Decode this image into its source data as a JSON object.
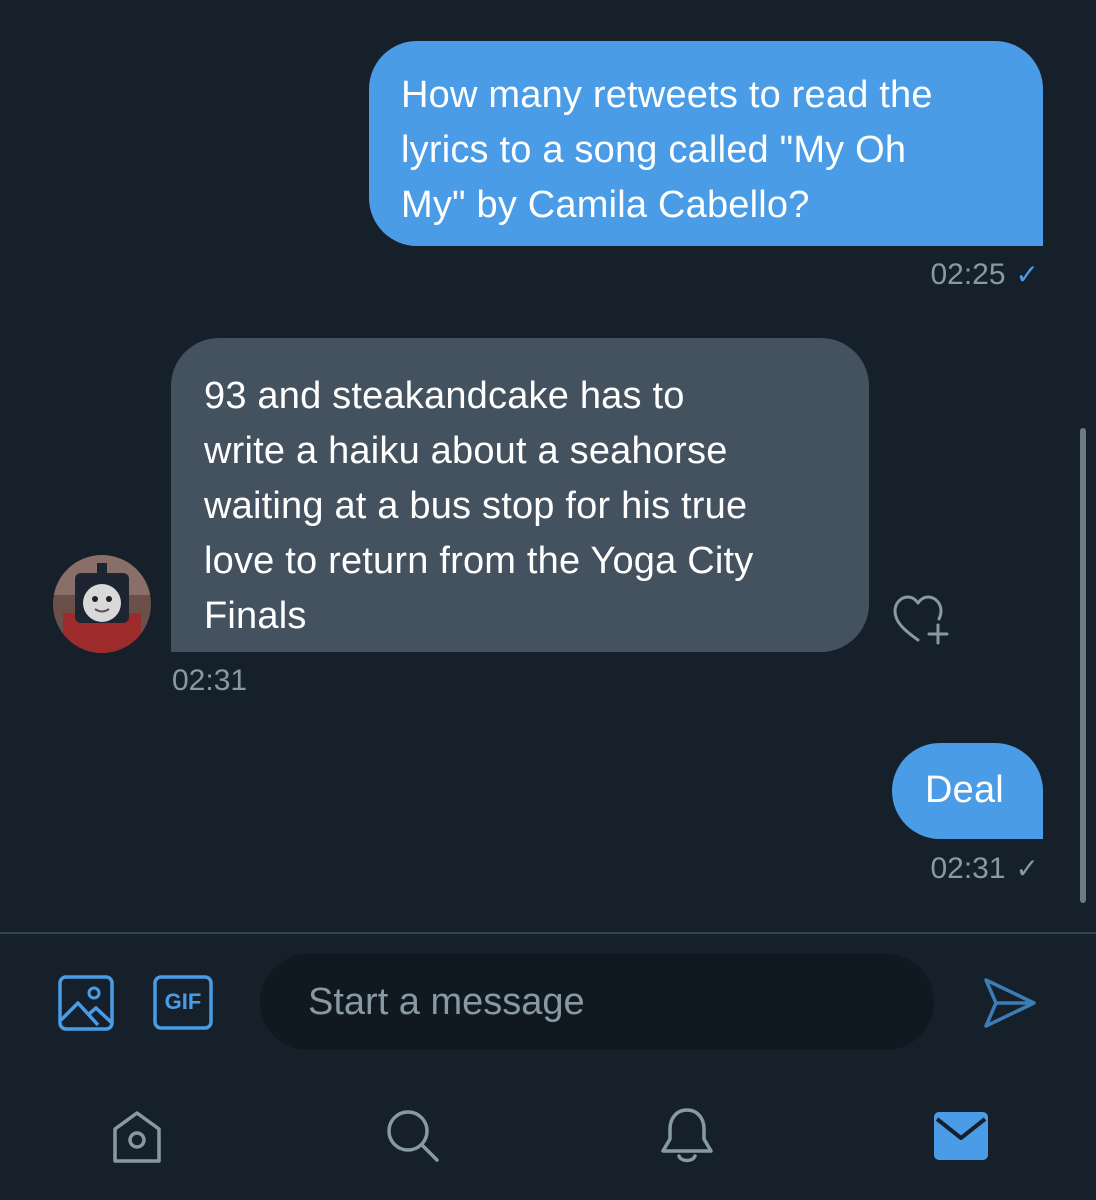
{
  "messages": [
    {
      "direction": "outgoing",
      "lines": [
        "How many retweets to read the",
        "lyrics to a song called \"My Oh",
        "My\" by Camila Cabello?"
      ],
      "time": "02:25",
      "status": "✓"
    },
    {
      "direction": "incoming",
      "lines": [
        "93 and steakandcake has to",
        "write a haiku about a seahorse",
        "waiting at a bus stop for his true",
        "love to return from the Yoga City",
        "Finals"
      ],
      "time": "02:31"
    },
    {
      "direction": "outgoing",
      "lines": [
        "Deal"
      ],
      "time": "02:31",
      "status": "✓"
    }
  ],
  "composer": {
    "placeholder": "Start a message",
    "gif_label": "GIF"
  },
  "icons": {
    "media": "image-icon",
    "gif": "gif-icon",
    "send": "send-icon",
    "like": "heart-plus-icon",
    "home": "home-icon",
    "search": "search-icon",
    "notifications": "bell-icon",
    "messages": "mail-icon"
  },
  "colors": {
    "background": "#15202b",
    "outgoing_bubble": "#4a9ce6",
    "incoming_bubble": "#44515f",
    "accent": "#4a9ce6",
    "muted": "#8899a6"
  }
}
